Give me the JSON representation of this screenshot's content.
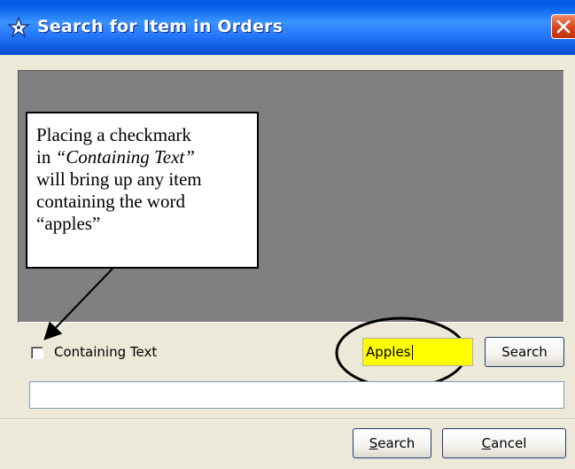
{
  "window": {
    "title": "Search for Item in Orders",
    "icon": "star-window-icon",
    "close_icon": "close-icon"
  },
  "callout": {
    "line1": "Placing a checkmark",
    "line2_prefix": "in ",
    "line2_italic": "“Containing Text”",
    "line3": "will bring up any item",
    "line4": "containing the word",
    "line5": "“apples”"
  },
  "options": {
    "containing_text_label": "Containing Text",
    "containing_text_checked": false
  },
  "search": {
    "input_value": "Apples",
    "search_button_label": "Search"
  },
  "footer": {
    "search_label_mnemonic": "S",
    "search_label_rest": "earch",
    "cancel_label_mnemonic": "C",
    "cancel_label_rest": "ancel"
  },
  "colors": {
    "title_bar": "#2a7dff",
    "input_highlight": "#ffff00",
    "preview_pane": "#808080",
    "dialog_bg": "#ece9d8"
  }
}
